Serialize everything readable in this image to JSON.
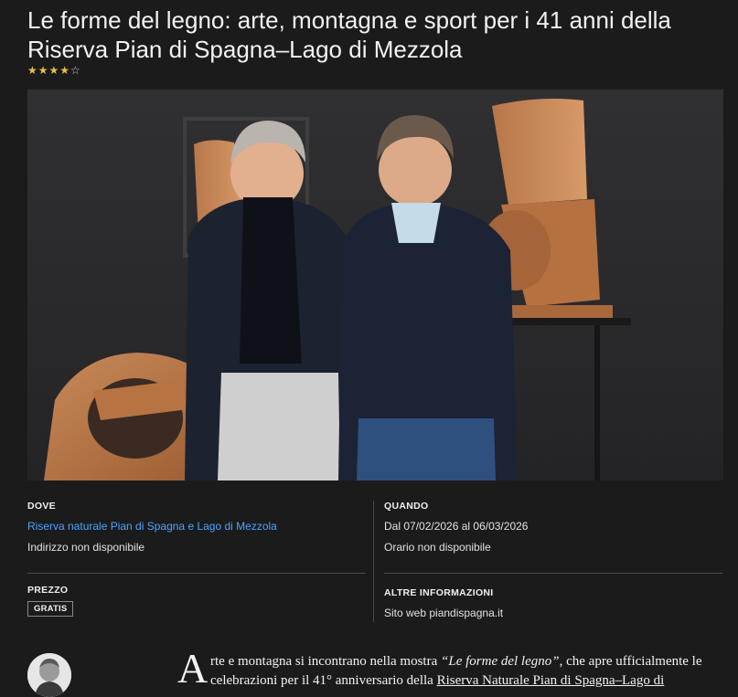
{
  "article": {
    "title": "Le forme del legno: arte, montagna e sport per i 41 anni della Riserva Pian di Spagna–Lago di Mezzola",
    "rating": {
      "value": 4,
      "max": 5,
      "filled_stars": "★★★★",
      "empty_stars": "☆"
    },
    "hero_image_alt": "Due uomini sorridenti accanto a sculture in legno"
  },
  "info": {
    "dove": {
      "label": "DOVE",
      "place": "Riserva naturale Pian di Spagna e Lago di Mezzola",
      "address": "Indirizzo non disponibile"
    },
    "quando": {
      "label": "QUANDO",
      "dates": "Dal 07/02/2026 al 06/03/2026",
      "hours": "Orario non disponibile"
    },
    "prezzo": {
      "label": "PREZZO",
      "badge": "GRATIS"
    },
    "altre": {
      "label": "ALTRE INFORMAZIONI",
      "website_prefix": "Sito web ",
      "website": "piandispagna.it"
    }
  },
  "body": {
    "dropcap": "A",
    "p1_a": "rte e montagna si incontrano nella mostra ",
    "p1_title": "“Le forme del legno”",
    "p1_b": ", che apre ufficialmente le celebrazioni per il 41° anniversario della ",
    "p1_link": "Riserva Naturale Pian di Spagna–Lago di"
  },
  "colors": {
    "background": "#1b1b1b",
    "link": "#4aa3ff",
    "star": "#e8c04a"
  }
}
